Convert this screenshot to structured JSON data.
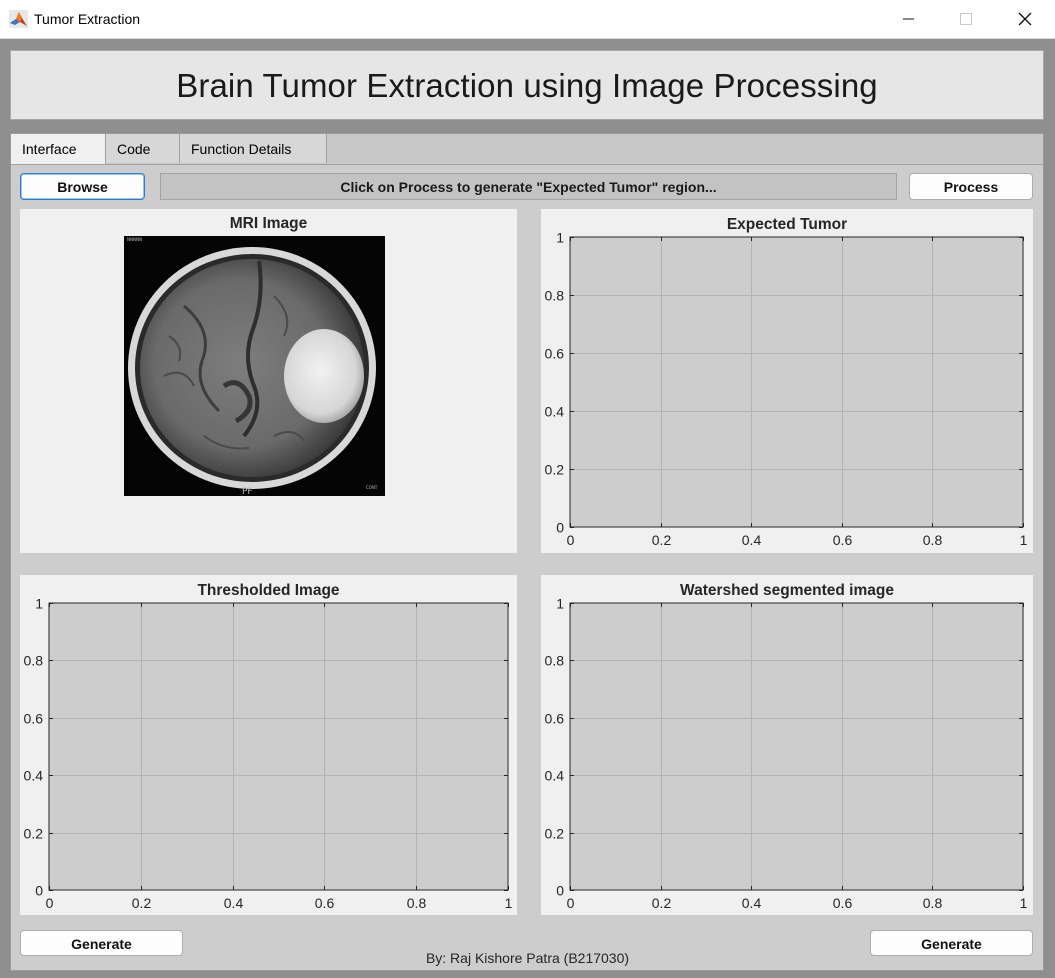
{
  "window": {
    "title": "Tumor Extraction",
    "icon": "matlab-icon"
  },
  "banner": {
    "title": "Brain Tumor Extraction using Image Processing"
  },
  "tabs": [
    {
      "label": "Interface",
      "active": true
    },
    {
      "label": "Code",
      "active": false
    },
    {
      "label": "Function Details",
      "active": false
    }
  ],
  "toolbar": {
    "browse_label": "Browse",
    "status_text": "Click on Process to generate \"Expected Tumor\" region...",
    "process_label": "Process"
  },
  "panels": {
    "mri": {
      "title": "MRI Image"
    },
    "expected": {
      "title": "Expected Tumor"
    },
    "thresholded": {
      "title": "Thresholded Image"
    },
    "watershed": {
      "title": "Watershed segmented image"
    }
  },
  "axes_ticks": {
    "x": [
      "0",
      "0.2",
      "0.4",
      "0.6",
      "0.8",
      "1"
    ],
    "y": [
      "0",
      "0.2",
      "0.4",
      "0.6",
      "0.8",
      "1"
    ]
  },
  "bottom": {
    "generate_left_label": "Generate",
    "generate_right_label": "Generate",
    "credit": "By: Raj Kishore Patra (B217030)"
  },
  "colors": {
    "axes_bg": "#cdcdcd",
    "grid": "#b4b4b4",
    "panel_bg": "#f0f0f0",
    "focus": "#2b7cd3"
  }
}
